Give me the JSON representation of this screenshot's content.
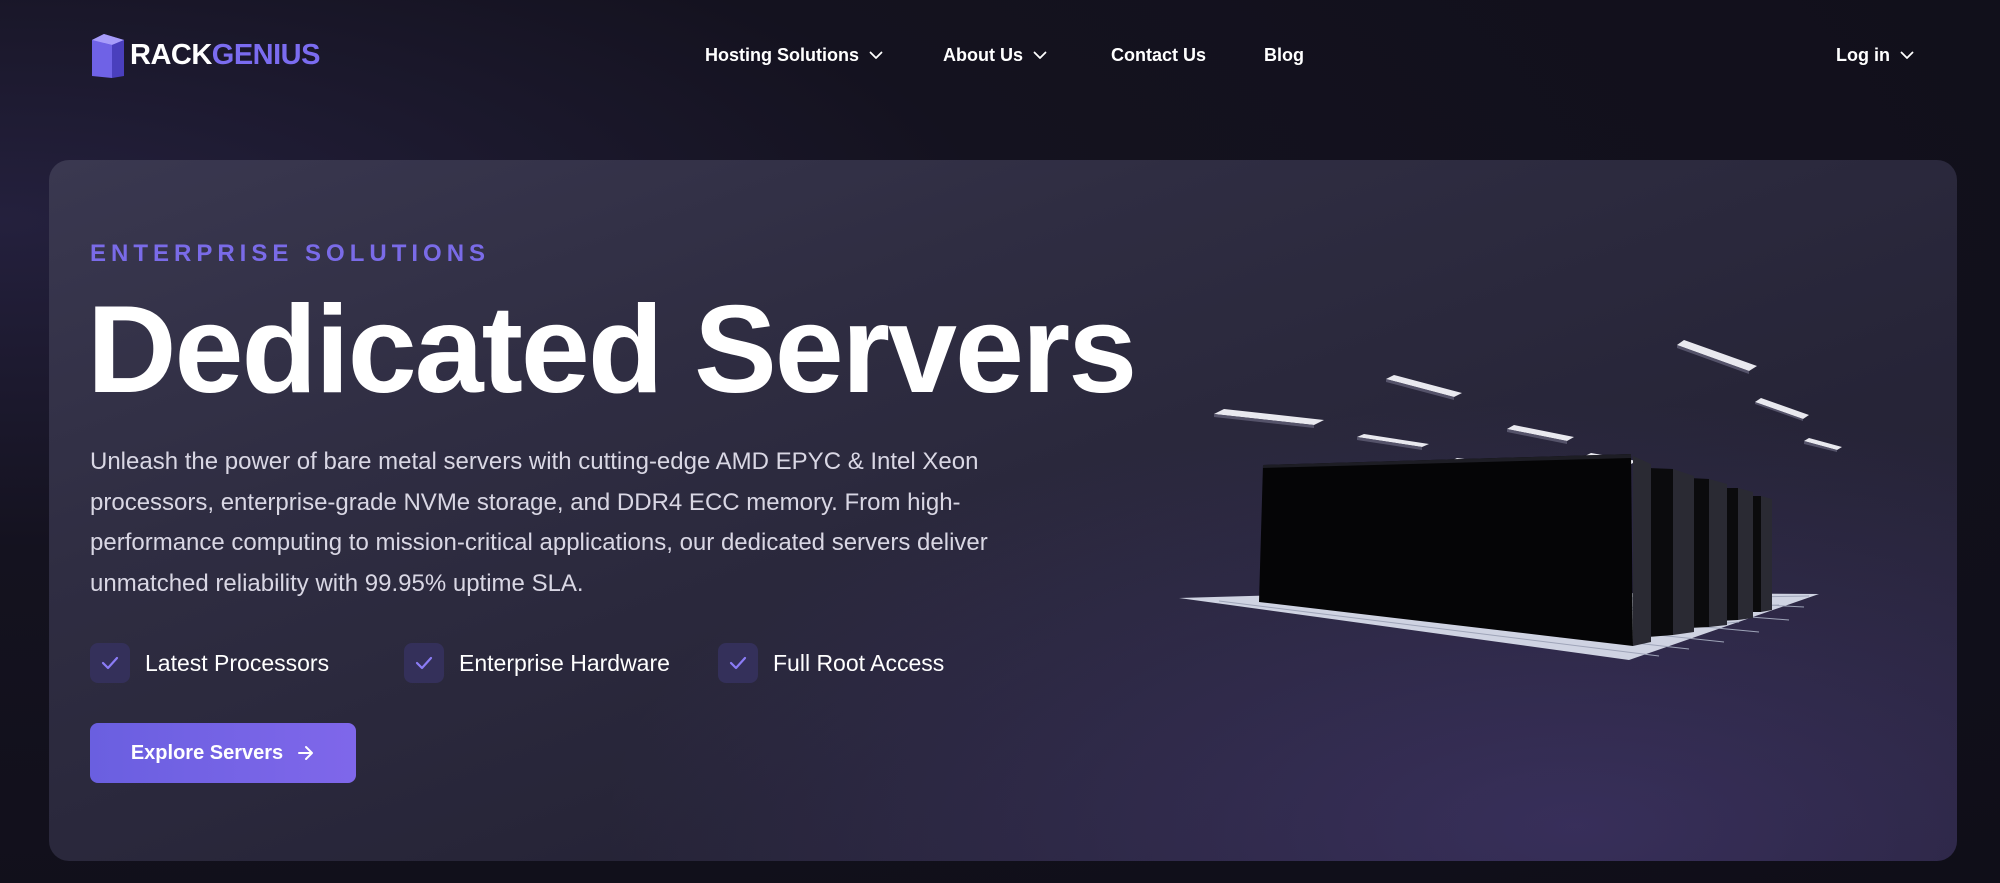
{
  "brand": {
    "name_part1": "RACK",
    "name_part2": "GENIUS",
    "accent_color": "#7b6cf0"
  },
  "nav": {
    "items": [
      {
        "label": "Hosting Solutions",
        "has_dropdown": true
      },
      {
        "label": "About Us",
        "has_dropdown": true
      },
      {
        "label": "Contact Us",
        "has_dropdown": false
      },
      {
        "label": "Blog",
        "has_dropdown": false
      }
    ],
    "login": {
      "label": "Log in",
      "has_dropdown": true
    }
  },
  "hero": {
    "eyebrow": "ENTERPRISE SOLUTIONS",
    "title": "Dedicated Servers",
    "description": "Unleash the power of bare metal servers with cutting-edge AMD EPYC & Intel Xeon processors, enterprise-grade NVMe storage, and DDR4 ECC memory. From high-performance computing to mission-critical applications, our dedicated servers deliver unmatched reliability with 99.95% uptime SLA.",
    "features": [
      {
        "label": "Latest Processors",
        "icon": "check-icon"
      },
      {
        "label": "Enterprise Hardware",
        "icon": "check-icon"
      },
      {
        "label": "Full Root Access",
        "icon": "check-icon"
      }
    ],
    "cta": {
      "label": "Explore Servers",
      "icon": "arrow-right-icon"
    },
    "illustration": "server-rack-illustration"
  },
  "colors": {
    "background": "#13111d",
    "card": "#2f2d42",
    "accent": "#7a6be8",
    "check_bg": "#34305a"
  }
}
